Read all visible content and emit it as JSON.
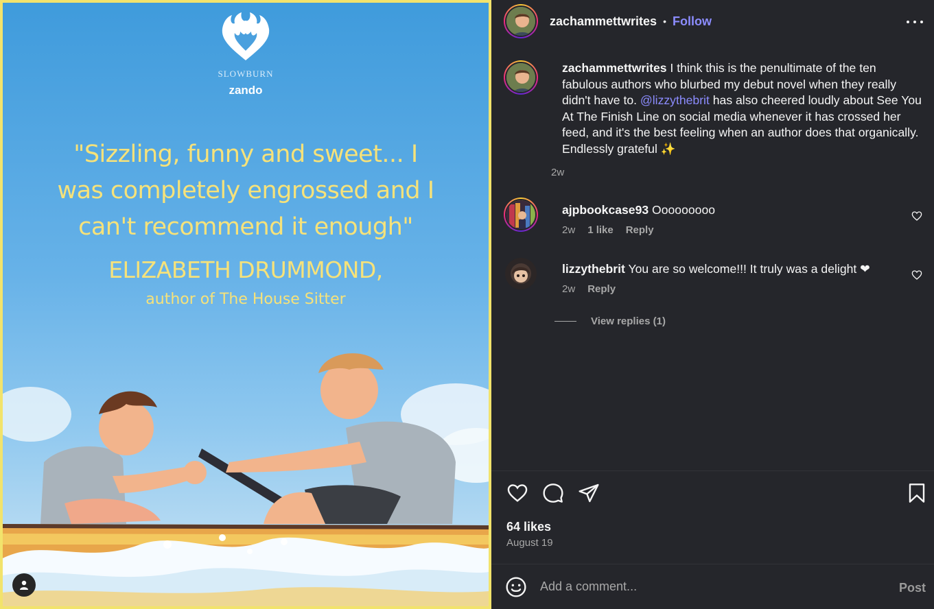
{
  "post_image": {
    "imprint": "SLOWBURN",
    "publisher": "zando",
    "quote_lines": [
      "\"Sizzling, funny and sweet... I",
      "was completely engrossed and I",
      "can't recommend it enough\""
    ],
    "quote_author": "ELIZABETH DRUMMOND,",
    "quote_author_sub": "author of The House Sitter"
  },
  "header": {
    "username": "zachammettwrites",
    "separator": "•",
    "follow_label": "Follow"
  },
  "caption": {
    "username": "zachammettwrites",
    "text_before": " I think this is the penultimate of the ten fabulous authors who blurbed my debut novel when they really didn't have to. ",
    "mention": "@lizzythebrit",
    "text_after": " has also cheered loudly about See You At The Finish Line on social media whenever it has crossed her feed, and it's the best feeling when an author does that organically. Endlessly grateful ✨",
    "time": "2w"
  },
  "comments": [
    {
      "username": "ajpbookcase93",
      "text": " Ooooooooo",
      "time": "2w",
      "likes": "1 like",
      "reply_label": "Reply"
    },
    {
      "username": "lizzythebrit",
      "text": " You are so welcome!!! It truly was a delight ❤",
      "time": "2w",
      "reply_label": "Reply"
    }
  ],
  "view_replies": "View replies (1)",
  "stats": {
    "likes": "64 likes",
    "date": "August 19"
  },
  "composer": {
    "placeholder": "Add a comment...",
    "post_label": "Post"
  },
  "icons": [
    "heart-icon",
    "comment-icon",
    "share-icon",
    "bookmark-icon",
    "emoji-icon",
    "more-icon",
    "user-tag-icon"
  ],
  "colors": {
    "background": "#25262b",
    "link": "#8c8cff",
    "muted": "#a8a8a8",
    "quote_yellow": "#f6e27a",
    "frame_yellow": "#f2e36c"
  }
}
